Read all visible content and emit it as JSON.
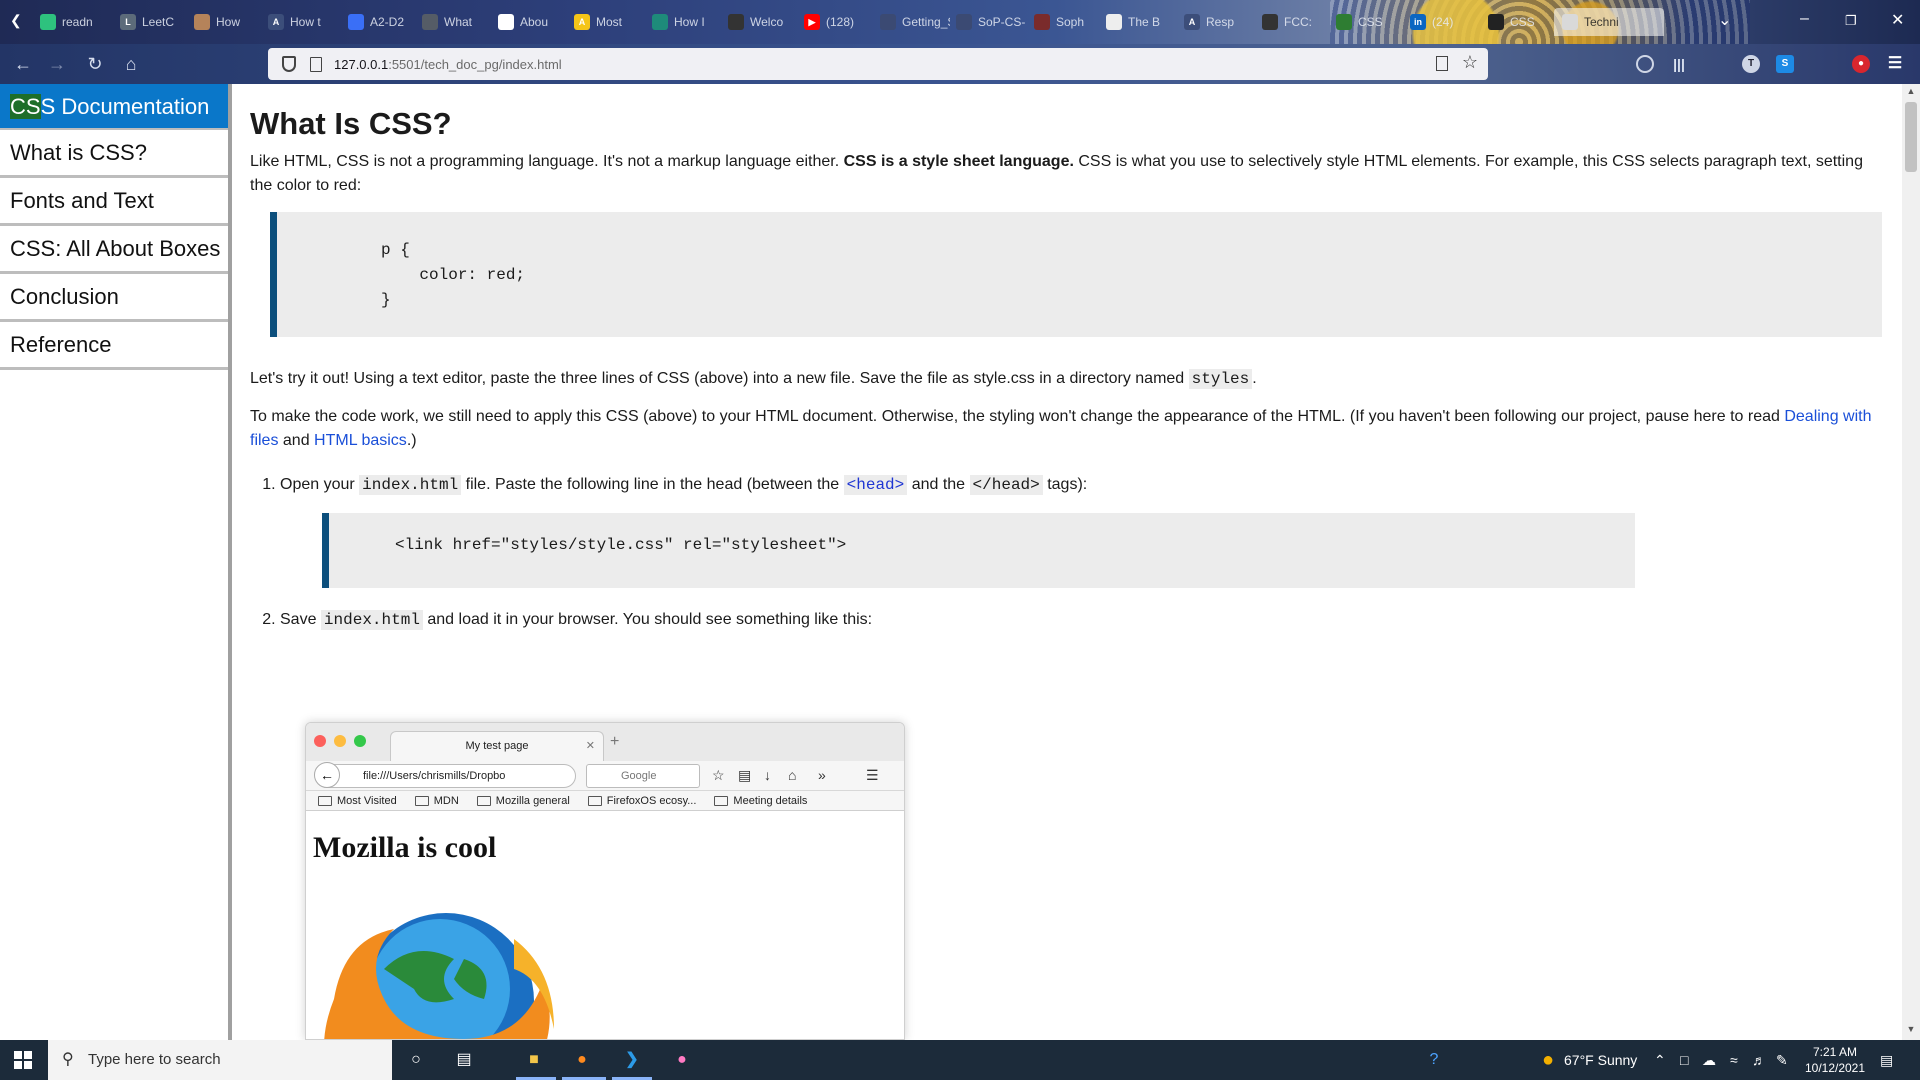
{
  "browser": {
    "tabs": [
      {
        "label": "readn",
        "color": "#2ec27e",
        "glyph": ""
      },
      {
        "label": "LeetC",
        "color": "#5c6b7a",
        "glyph": "L"
      },
      {
        "label": "How",
        "color": "#b5835a",
        "glyph": ""
      },
      {
        "label": "How t",
        "color": "#3c4e7a",
        "glyph": "A"
      },
      {
        "label": "A2-D2",
        "color": "#3a6ff7",
        "glyph": ""
      },
      {
        "label": "What",
        "color": "#555c66",
        "glyph": ""
      },
      {
        "label": "Abou",
        "color": "#ffffff",
        "glyph": ""
      },
      {
        "label": "Most",
        "color": "#f5c518",
        "glyph": "A"
      },
      {
        "label": "How I",
        "color": "#1e8b7a",
        "glyph": ""
      },
      {
        "label": "Welco",
        "color": "#333333",
        "glyph": ""
      },
      {
        "label": "(128)",
        "color": "#ff0000",
        "glyph": "▶"
      },
      {
        "label": "Getting_St",
        "color": "#3b4a73",
        "glyph": ""
      },
      {
        "label": "SoP-CS-C",
        "color": "#3b4a73",
        "glyph": ""
      },
      {
        "label": "Soph",
        "color": "#7a2b2b",
        "glyph": ""
      },
      {
        "label": "The B",
        "color": "#eeeeee",
        "glyph": ""
      },
      {
        "label": "Resp",
        "color": "#3c4e7a",
        "glyph": "A"
      },
      {
        "label": "FCC:",
        "color": "#333333",
        "glyph": ""
      },
      {
        "label": "CSS",
        "color": "#2e7d32",
        "glyph": ""
      },
      {
        "label": "(24)",
        "color": "#0a66c2",
        "glyph": "in"
      },
      {
        "label": "CSS",
        "color": "#222222",
        "glyph": ""
      },
      {
        "label": "Techni",
        "color": "#d9d9d9",
        "glyph": ""
      }
    ],
    "url_host": "127.0.0.1",
    "url_rest": ":5501/tech_doc_pg/index.html"
  },
  "sidebar": {
    "header": "CSS Documentation",
    "header_first": "CS",
    "header_rest": "S Documentation",
    "links": [
      "What is CSS?",
      "Fonts and Text",
      "CSS: All About Boxes",
      "Conclusion",
      "Reference"
    ]
  },
  "main": {
    "title": "What Is CSS?",
    "intro_a": "Like HTML, CSS is not a programming language. It's not a markup language either. ",
    "intro_bold": "CSS is a style sheet language.",
    "intro_b": " CSS is what you use to selectively style HTML elements. For example, this CSS selects paragraph text, setting the color to red:",
    "code1": "p {\n    color: red;\n}",
    "p2_a": "Let's try it out! Using a text editor, paste the three lines of CSS (above) into a new file. Save the file as style.css in a directory named ",
    "p2_code": "styles",
    "p2_b": ".",
    "p3_a": "To make the code work, we still need to apply this CSS (above) to your HTML document. Otherwise, the styling won't change the appearance of the HTML. (If you haven't been following our project, pause here to read ",
    "p3_link1": "Dealing with files",
    "p3_mid": " and ",
    "p3_link2": "HTML basics",
    "p3_b": ".)",
    "step1_a": "Open your ",
    "step1_code1": "index.html",
    "step1_b": " file. Paste the following line in the head (between the ",
    "step1_code2": "<head>",
    "step1_c": " and the ",
    "step1_code3": "</head>",
    "step1_d": " tags):",
    "code2": "<link href=\"styles/style.css\" rel=\"stylesheet\">",
    "step2_a": "Save ",
    "step2_code": "index.html",
    "step2_b": " and load it in your browser. You should see something like this:"
  },
  "screenshot": {
    "tab_title": "My test page",
    "url": "file:///Users/chrismills/Dropbo",
    "search_placeholder": "Google",
    "bookmarks": [
      "Most Visited",
      "MDN",
      "Mozilla general",
      "FirefoxOS ecosy...",
      "Meeting details"
    ],
    "heading": "Mozilla is cool"
  },
  "taskbar": {
    "search_placeholder": "Type here to search",
    "weather": "67°F  Sunny",
    "time": "7:21 AM",
    "date": "10/12/2021"
  },
  "colors": {
    "sidebar_header_bg": "#0a77c9",
    "code_border": "#0c4f7c",
    "link": "#1a4fd8"
  }
}
